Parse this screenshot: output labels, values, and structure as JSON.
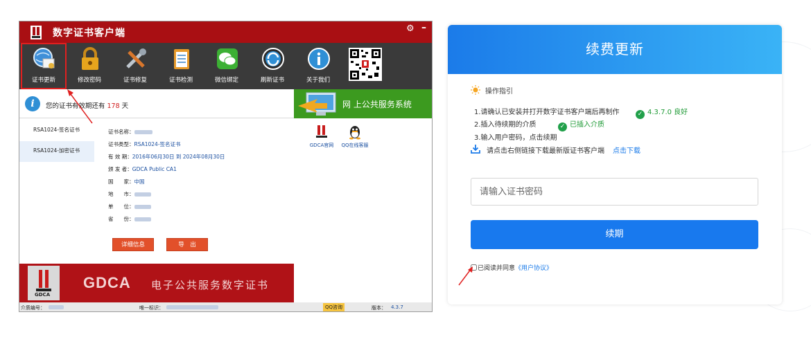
{
  "colors": {
    "app_red": "#a90f13",
    "toolbar_dark": "#3a3a3a",
    "accent_blue": "#1879ee",
    "success_green": "#21a04a",
    "days_red": "#d01e1e",
    "service_green": "#3c9a1f"
  },
  "app": {
    "title": "数字证书客户端",
    "toolbar": [
      {
        "label": "证书更新",
        "icon": "globe-certificate-icon"
      },
      {
        "label": "修改密码",
        "icon": "padlock-icon"
      },
      {
        "label": "证书修复",
        "icon": "tools-icon"
      },
      {
        "label": "证书检测",
        "icon": "clipboard-checklist-icon"
      },
      {
        "label": "微信绑定",
        "icon": "wechat-icon"
      },
      {
        "label": "刷新证书",
        "icon": "refresh-icon"
      },
      {
        "label": "关于我们",
        "icon": "info-icon"
      }
    ],
    "validity": {
      "prefix": "您的证书有效期还有",
      "days": "178",
      "suffix": "天"
    },
    "service_banner": "网 上公共服务系统",
    "cert_list": [
      "RSA1024-签名证书",
      "RSA1024-加密证书"
    ],
    "details": [
      {
        "label": "证书名称：",
        "value": ""
      },
      {
        "label": "证书类型：",
        "value": "RSA1024-签名证书"
      },
      {
        "label": "有 效 期：",
        "value": "2016年06月30日 到 2024年08月30日"
      },
      {
        "label": "颁 发 者：",
        "value": "GDCA Public CA1"
      },
      {
        "label": "国　　家：",
        "value": "中国"
      },
      {
        "label": "地　　市：",
        "value": ""
      },
      {
        "label": "单　　位：",
        "value": ""
      },
      {
        "label": "省　　份：",
        "value": ""
      }
    ],
    "buttons": {
      "detail": "详细信息",
      "export": "导　出"
    },
    "links": {
      "gdca_site": "GDCA官网",
      "qq_service": "QQ在线客服"
    },
    "bottom_banner": {
      "brand": "GDCA",
      "slogan": "电子公共服务数字证书",
      "logo_text": "GDCA"
    },
    "statusbar": {
      "media_label": "介质编号：",
      "uid_label": "唯一标识：",
      "qq_button": "QQ咨询",
      "version_label": "版本：",
      "version": "4.3.7"
    }
  },
  "dialog": {
    "title": "续费更新",
    "guide_title": "操作指引",
    "steps": [
      "1.请确认已安装并打开数字证书客户端后再制作",
      "2.插入待续期的介质",
      "3.输入用户密码，点击续期"
    ],
    "status_version": "4.3.7.0 良好",
    "status_media": "已插入介质",
    "download_text": "请点击右侧链接下载最新版证书客户端",
    "download_link": "点击下载",
    "password_placeholder": "请输入证书密码",
    "renew_button": "续期",
    "agree_text": "已阅读并同意",
    "agree_link": "《用户协议》"
  }
}
